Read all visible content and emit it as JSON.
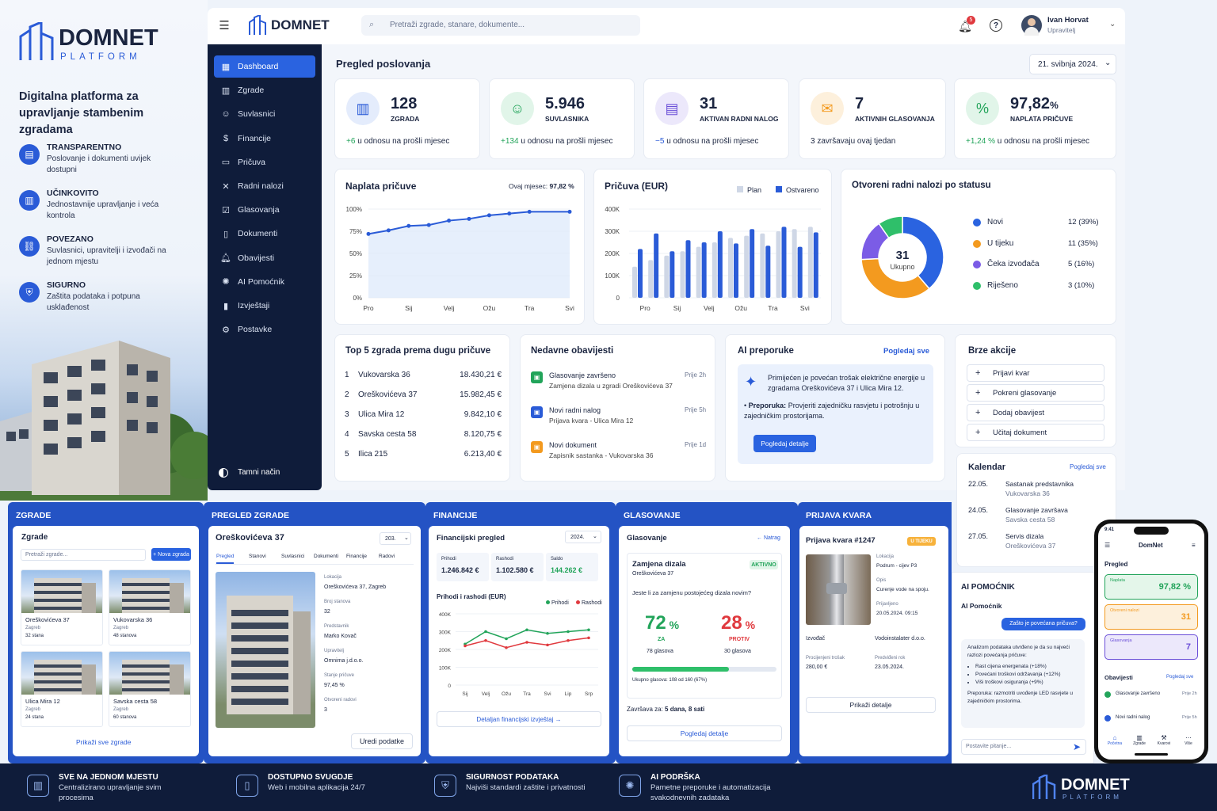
{
  "brand": {
    "name": "DOMNET",
    "sub": "PLATFORM",
    "tagline": "Digitalna platforma za upravljanje stambenim zgradama"
  },
  "features": [
    {
      "icon": "document-icon",
      "title": "TRANSPARENTNO",
      "desc": "Poslovanje i dokumenti uvijek dostupni"
    },
    {
      "icon": "building-icon",
      "title": "UČINKOVITO",
      "desc": "Jednostavnije upravljanje i veća kontrola"
    },
    {
      "icon": "link-icon",
      "title": "POVEZANO",
      "desc": "Suvlasnici, upravitelji i izvođači na jednom mjestu"
    },
    {
      "icon": "shield-icon",
      "title": "SIGURNO",
      "desc": "Zaštita podataka i potpuna usklađenost"
    }
  ],
  "header": {
    "logo": "DOMNET",
    "search_placeholder": "Pretraži zgrade, stanare, dokumente...",
    "notif_count": "5",
    "user_name": "Ivan Horvat",
    "user_role": "Upravitelj"
  },
  "sidebar": {
    "items": [
      {
        "icon": "dashboard-icon",
        "label": "Dashboard"
      },
      {
        "icon": "building-icon",
        "label": "Zgrade"
      },
      {
        "icon": "users-icon",
        "label": "Suvlasnici"
      },
      {
        "icon": "dollar-icon",
        "label": "Financije"
      },
      {
        "icon": "wallet-icon",
        "label": "Pričuva"
      },
      {
        "icon": "tools-icon",
        "label": "Radni nalozi"
      },
      {
        "icon": "vote-icon",
        "label": "Glasovanja"
      },
      {
        "icon": "file-icon",
        "label": "Dokumenti"
      },
      {
        "icon": "bell-icon",
        "label": "Obavijesti"
      },
      {
        "icon": "ai-icon",
        "label": "AI Pomoćnik"
      },
      {
        "icon": "report-icon",
        "label": "Izvještaji"
      },
      {
        "icon": "gear-icon",
        "label": "Postavke"
      }
    ],
    "dark_mode": "Tamni način"
  },
  "overview": {
    "title": "Pregled poslovanja",
    "date": "21. svibnja 2024."
  },
  "kpis": [
    {
      "value": "128",
      "label": "ZGRADA",
      "change": "+6",
      "change_text": "u odnosu na prošli mjesec",
      "color": "#2a5bd7",
      "bg": "#e4ecfc",
      "icon": "building-icon"
    },
    {
      "value": "5.946",
      "label": "SUVLASNIKA",
      "change": "+134",
      "change_text": "u odnosu na prošli mjesec",
      "color": "#22a45a",
      "bg": "#e1f5e9",
      "icon": "users-icon"
    },
    {
      "value": "31",
      "label": "AKTIVAN RADNI NALOG",
      "change": "−5",
      "change_text": "u odnosu na prošli mjesec",
      "color": "#6b4fd8",
      "bg": "#ece8fb",
      "icon": "clipboard-icon"
    },
    {
      "value": "7",
      "label": "AKTIVNIH GLASOVANJA",
      "change": "",
      "change_text": "3 završavaju ovaj tjedan",
      "color": "#f39a1f",
      "bg": "#fdf0dc",
      "icon": "ballot-icon"
    },
    {
      "value": "97,82",
      "unit": "%",
      "label": "NAPLATA PRIČUVE",
      "change": "+1,24 %",
      "change_text": "u odnosu na prošli mjesec",
      "color": "#22a45a",
      "bg": "#e1f5e9",
      "icon": "percent-icon"
    }
  ],
  "naplata": {
    "title": "Naplata pričuve",
    "month_label": "Ovaj mjesec:",
    "month_value": "97,82 %"
  },
  "pricuva": {
    "title": "Pričuva (EUR)",
    "legend_plan": "Plan",
    "legend_actual": "Ostvareno"
  },
  "nalozi": {
    "title": "Otvoreni radni nalozi po statusu",
    "center_value": "31",
    "center_label": "Ukupno",
    "items": [
      {
        "label": "Novi",
        "value": "12 (39%)",
        "color": "#2a63e0"
      },
      {
        "label": "U tijeku",
        "value": "11 (35%)",
        "color": "#f39a1f"
      },
      {
        "label": "Čeka izvođača",
        "value": "5 (16%)",
        "color": "#7b5ce6"
      },
      {
        "label": "Riješeno",
        "value": "3 (10%)",
        "color": "#2fbf6a"
      }
    ]
  },
  "chart_data": [
    {
      "type": "line",
      "title": "Naplata pričuve",
      "categories": [
        "Pro",
        "Sij",
        "Velj",
        "Ožu",
        "Tra",
        "Svi"
      ],
      "x": [
        0,
        0.5,
        1,
        1.5,
        2,
        2.5,
        3,
        3.5,
        4,
        4.5,
        5
      ],
      "values": [
        72,
        76,
        81,
        82,
        87,
        89,
        93,
        95,
        97,
        97,
        97
      ],
      "y_ticks": [
        "100%",
        "75%",
        "50%",
        "25%",
        "0%"
      ],
      "ylim": [
        0,
        100
      ]
    },
    {
      "type": "bar",
      "title": "Pričuva (EUR)",
      "categories": [
        "Pro",
        "Sij",
        "Velj",
        "Ožu",
        "Tra",
        "Svi"
      ],
      "series": [
        {
          "name": "Plan",
          "values": [
            140,
            170,
            190,
            210,
            230,
            250,
            270,
            280,
            290,
            300,
            310,
            320
          ]
        },
        {
          "name": "Ostvareno",
          "values": [
            220,
            290,
            210,
            260,
            250,
            300,
            245,
            310,
            235,
            320,
            230,
            295
          ]
        }
      ],
      "y_ticks": [
        "400K",
        "300K",
        "200K",
        "100K",
        "0"
      ],
      "ylim": [
        0,
        400
      ]
    },
    {
      "type": "pie",
      "title": "Otvoreni radni nalozi po statusu",
      "categories": [
        "Novi",
        "U tijeku",
        "Čeka izvođača",
        "Riješeno"
      ],
      "values": [
        12,
        11,
        5,
        3
      ]
    },
    {
      "type": "line",
      "title": "Prihodi i rashodi (EUR)",
      "categories": [
        "Sij",
        "Velj",
        "Ožu",
        "Tra",
        "Svi",
        "Lip",
        "Srp"
      ],
      "series": [
        {
          "name": "Prihodi",
          "values": [
            230,
            300,
            260,
            310,
            290,
            300,
            310
          ]
        },
        {
          "name": "Rashodi",
          "values": [
            220,
            250,
            210,
            240,
            225,
            250,
            265
          ]
        }
      ],
      "y_ticks": [
        "400K",
        "300K",
        "200K",
        "100K",
        "0"
      ],
      "ylim": [
        0,
        400
      ]
    }
  ],
  "top5": {
    "title": "Top 5 zgrada prema dugu pričuve",
    "rows": [
      {
        "n": "1",
        "name": "Vukovarska 36",
        "value": "18.430,21 €"
      },
      {
        "n": "2",
        "name": "Oreškovićeva 37",
        "value": "15.982,45 €"
      },
      {
        "n": "3",
        "name": "Ulica Mira 12",
        "value": "9.842,10 €"
      },
      {
        "n": "4",
        "name": "Savska cesta 58",
        "value": "8.120,75 €"
      },
      {
        "n": "5",
        "name": "Ilica 215",
        "value": "6.213,40 €"
      }
    ]
  },
  "notices": {
    "title": "Nedavne obavijesti",
    "items": [
      {
        "title": "Glasovanje završeno",
        "sub": "Zamjena dizala u zgradi Oreškovićeva 37",
        "time": "Prije 2h",
        "color": "#22a45a"
      },
      {
        "title": "Novi radni nalog",
        "sub": "Prijava kvara - Ulica Mira 12",
        "time": "Prije 5h",
        "color": "#2a5bd7"
      },
      {
        "title": "Novi dokument",
        "sub": "Zapisnik sastanka - Vukovarska 36",
        "time": "Prije 1d",
        "color": "#f39a1f"
      }
    ]
  },
  "ai": {
    "title": "AI preporuke",
    "link": "Pogledaj sve",
    "text": "Primijećen je povećan trošak električne energije u zgradama Oreškovićeva 37 i Ulica Mira 12.",
    "rec_label": "Preporuka:",
    "rec": "Provjeriti zajedničku rasvjetu i potrošnju u zajedničkim prostorijama.",
    "button": "Pogledaj detalje"
  },
  "quick": {
    "title": "Brze akcije",
    "items": [
      "Prijavi kvar",
      "Pokreni glasovanje",
      "Dodaj obavijest",
      "Učitaj dokument"
    ]
  },
  "calendar": {
    "title": "Kalendar",
    "link": "Pogledaj sve",
    "events": [
      {
        "date": "22.05.",
        "title": "Sastanak predstavnika",
        "sub": "Vukovarska 36"
      },
      {
        "date": "24.05.",
        "title": "Glasovanje završava",
        "sub": "Savska cesta 58"
      },
      {
        "date": "27.05.",
        "title": "Servis dizala",
        "sub": "Oreškovićeva 37"
      }
    ]
  },
  "p_zgrade": {
    "section": "ZGRADE",
    "title": "Zgrade",
    "search": "Pretraži zgrade...",
    "new": "+ Nova zgrada",
    "buildings": [
      {
        "name": "Oreškovićeva 37",
        "city": "Zagreb",
        "units": "32 stana"
      },
      {
        "name": "Vukovarska 36",
        "city": "Zagreb",
        "units": "48 stanova"
      },
      {
        "name": "Ulica Mira 12",
        "city": "Zagreb",
        "units": "24 stana"
      },
      {
        "name": "Savska cesta 58",
        "city": "Zagreb",
        "units": "60 stanova"
      }
    ],
    "link": "Prikaži sve zgrade"
  },
  "p_pregled": {
    "section": "PREGLED ZGRADE",
    "title": "Oreškovićeva 37",
    "select": "203.",
    "tabs": [
      "Pregled",
      "Stanovi",
      "Suvlasnici",
      "Dokumenti",
      "Financije",
      "Radovi"
    ],
    "fields": [
      {
        "k": "Lokacija",
        "v": "Oreškovićeva 37, Zagreb"
      },
      {
        "k": "Broj stanova",
        "v": "32"
      },
      {
        "k": "Predstavnik",
        "v": "Marko Kovač"
      },
      {
        "k": "Upravitelj",
        "v": "Omnima j.d.o.o."
      },
      {
        "k": "Stanje pričuve",
        "v": "97,45 %"
      },
      {
        "k": "Otvoreni radovi",
        "v": "3"
      }
    ],
    "button": "Uredi podatke"
  },
  "p_fin": {
    "section": "FINANCIJE",
    "title": "Financijski pregled",
    "select": "2024.",
    "stats": [
      {
        "k": "Prihodi",
        "v": "1.246.842 €"
      },
      {
        "k": "Rashodi",
        "v": "1.102.580 €"
      },
      {
        "k": "Saldo",
        "v": "144.262 €"
      }
    ],
    "chart_title": "Prihodi i rashodi (EUR)",
    "legend_in": "Prihodi",
    "legend_out": "Rashodi",
    "link": "Detaljan financijski izvještaj →"
  },
  "p_glas": {
    "section": "GLASOVANJE",
    "title": "Glasovanje",
    "back": "← Natrag",
    "vote_title": "Zamjena dizala",
    "vote_sub": "Oreškovićeva 37",
    "badge": "AKTIVNO",
    "question": "Jeste li za zamjenu postojećeg dizala novim?",
    "yes_pct": "72",
    "yes_label": "ZA",
    "yes_votes": "78 glasova",
    "no_pct": "28",
    "no_label": "PROTIV",
    "no_votes": "30 glasova",
    "progress": 0.67,
    "turnout": "Ukupno glasova: 108 od 160 (67%)",
    "ends_label": "Završava za:",
    "ends": "5 dana, 8 sati",
    "button": "Pogledaj detalje"
  },
  "p_kvar": {
    "section": "PRIJAVA KVARA",
    "title": "Prijava kvara #1247",
    "badge": "U TIJEKU",
    "fields": [
      {
        "k": "Lokacija",
        "v": "Podrum - cijev P3"
      },
      {
        "k": "Opis",
        "v": "Curenje vode na spoju."
      },
      {
        "k": "Prijavljeno",
        "v": "20.05.2024. 09:15"
      }
    ],
    "izvodac_label": "Izvođač",
    "izvodac": "Vodoinstalater d.o.o.",
    "cost_label": "Procijenjeni trošak",
    "cost": "280,00 €",
    "due_label": "Predviđeni rok",
    "due": "23.05.2024.",
    "button": "Prikaži detalje"
  },
  "p_ai": {
    "section": "AI POMOĆNIK",
    "title": "AI Pomoćnik",
    "question": "Zašto je povećana pričuva?",
    "answer_intro": "Analizom podataka utvrđeno je da su najveći razlozi povećanja pričuve:",
    "bullets": [
      "Rast cijena energenata (+18%)",
      "Povećani troškovi održavanja (+12%)",
      "Viši troškovi osiguranja (+9%)"
    ],
    "advice": "Preporuka: razmotriti uvođenje LED rasvjete u zajedničkim prostorima.",
    "input_placeholder": "Postavite pitanje..."
  },
  "phone": {
    "time": "9:41",
    "title": "DomNet",
    "section": "Pregled",
    "stats": [
      {
        "label": "Naplata",
        "value": "97,82 %",
        "color": "#22a45a",
        "bg": "#e4f6ea"
      },
      {
        "label": "Otvoreni nalozi",
        "value": "31",
        "color": "#f39a1f",
        "bg": "#fdf0dc"
      },
      {
        "label": "Glasovanja",
        "value": "7",
        "color": "#6b4fd8",
        "bg": "#ece8fb"
      }
    ],
    "notices_title": "Obavijesti",
    "notices_link": "Pogledaj sve",
    "notices": [
      {
        "title": "Glasovanje završeno",
        "time": "Prije 2h",
        "color": "#22a45a"
      },
      {
        "title": "Novi radni nalog",
        "time": "Prije 5h",
        "color": "#2a5bd7"
      }
    ],
    "nav": [
      "Početna",
      "Zgrade",
      "Kvarovi",
      "Više"
    ]
  },
  "footer": [
    {
      "icon": "building-icon",
      "title": "SVE NA JEDNOM MJESTU",
      "desc": "Centralizirano upravljanje svim procesima"
    },
    {
      "icon": "phone-icon",
      "title": "DOSTUPNO SVUGDJE",
      "desc": "Web i mobilna aplikacija 24/7"
    },
    {
      "icon": "shield-icon",
      "title": "SIGURNOST PODATAKA",
      "desc": "Najviši standardi zaštite i privatnosti"
    },
    {
      "icon": "ai-icon",
      "title": "AI PODRŠKA",
      "desc": "Pametne preporuke i automatizacija svakodnevnih zadataka"
    }
  ],
  "footer_brand": {
    "name": "DOMNET",
    "sub": "PLATFORM"
  }
}
